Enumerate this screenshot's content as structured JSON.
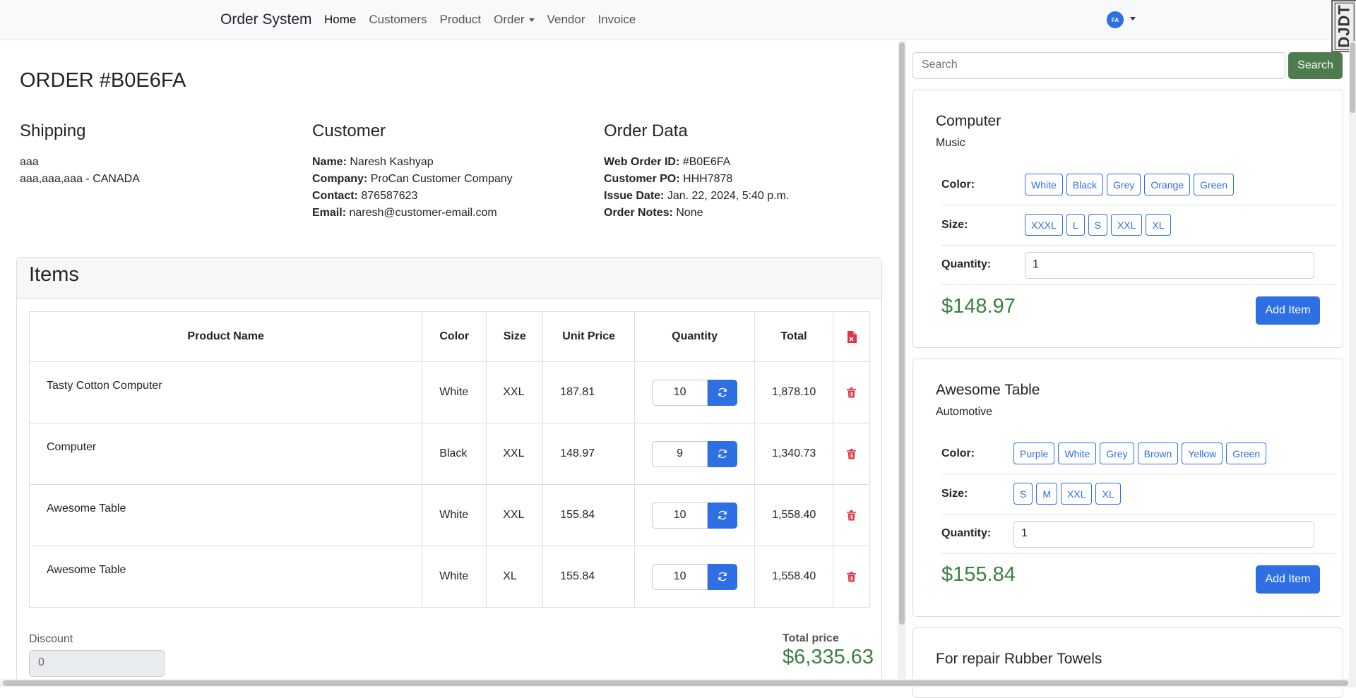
{
  "navbar": {
    "brand": "Order System",
    "links": [
      "Home",
      "Customers",
      "Product",
      "Order",
      "Vendor",
      "Invoice"
    ],
    "user_initials": "FA",
    "debug_toolbar": "DJDT"
  },
  "order": {
    "title": "ORDER #B0E6FA",
    "shipping": {
      "heading": "Shipping",
      "line1": "aaa",
      "line2": "aaa,aaa,aaa - CANADA"
    },
    "customer": {
      "heading": "Customer",
      "name_label": "Name:",
      "name": "Naresh Kashyap",
      "company_label": "Company:",
      "company": "ProCan Customer Company",
      "contact_label": "Contact:",
      "contact": "876587623",
      "email_label": "Email:",
      "email": "naresh@customer-email.com"
    },
    "order_data": {
      "heading": "Order Data",
      "web_id_label": "Web Order ID:",
      "web_id": "#B0E6FA",
      "po_label": "Customer PO:",
      "po": "HHH7878",
      "issue_label": "Issue Date:",
      "issue": "Jan. 22, 2024, 5:40 p.m.",
      "notes_label": "Order Notes:",
      "notes": "None"
    }
  },
  "items": {
    "heading": "Items",
    "columns": [
      "Product Name",
      "Color",
      "Size",
      "Unit Price",
      "Quantity",
      "Total"
    ],
    "rows": [
      {
        "name": "Tasty Cotton Computer",
        "color": "White",
        "size": "XXL",
        "unit_price": "187.81",
        "quantity": "10",
        "total": "1,878.10"
      },
      {
        "name": "Computer",
        "color": "Black",
        "size": "XXL",
        "unit_price": "148.97",
        "quantity": "9",
        "total": "1,340.73"
      },
      {
        "name": "Awesome Table",
        "color": "White",
        "size": "XXL",
        "unit_price": "155.84",
        "quantity": "10",
        "total": "1,558.40"
      },
      {
        "name": "Awesome Table",
        "color": "White",
        "size": "XL",
        "unit_price": "155.84",
        "quantity": "10",
        "total": "1,558.40"
      }
    ],
    "discount_label": "Discount",
    "discount_value": "0",
    "total_label": "Total price",
    "total_value": "$6,335.63"
  },
  "sidebar": {
    "search_placeholder": "Search",
    "search_button": "Search",
    "color_label": "Color:",
    "size_label": "Size:",
    "quantity_label": "Quantity:",
    "add_button": "Add Item",
    "products": [
      {
        "name": "Computer",
        "category": "Music",
        "colors": [
          "White",
          "Black",
          "Grey",
          "Orange",
          "Green"
        ],
        "sizes": [
          "XXXL",
          "L",
          "S",
          "XXL",
          "XL"
        ],
        "quantity": "1",
        "price": "$148.97"
      },
      {
        "name": "Awesome Table",
        "category": "Automotive",
        "colors": [
          "Purple",
          "White",
          "Grey",
          "Brown",
          "Yellow",
          "Green"
        ],
        "sizes": [
          "S",
          "M",
          "XXL",
          "XL"
        ],
        "quantity": "1",
        "price": "$155.84"
      },
      {
        "name": "For repair Rubber Towels"
      }
    ]
  },
  "colors": {
    "primary": "#2f6fe4",
    "success_text": "#3c8043",
    "search_button": "#4e7c4f",
    "danger": "#dc3545"
  }
}
